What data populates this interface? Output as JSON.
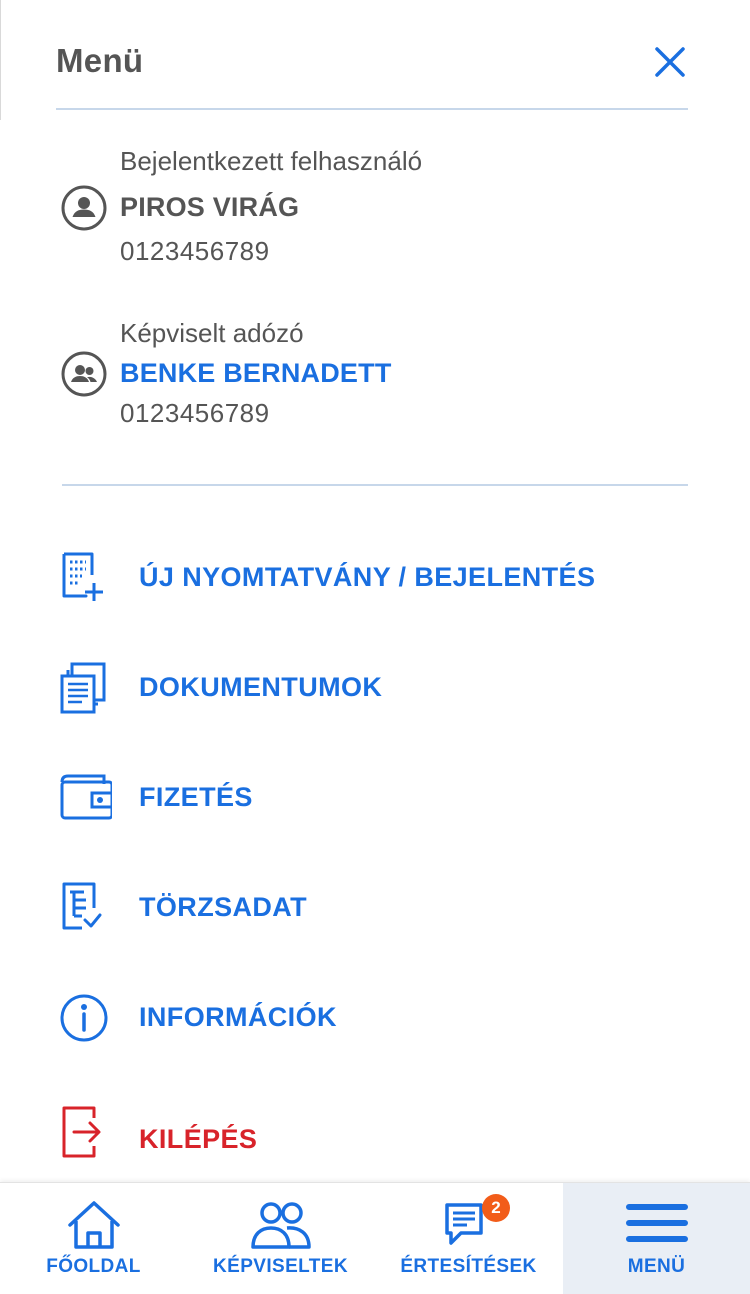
{
  "header": {
    "title": "Menü",
    "close_icon": "close-icon"
  },
  "logged_in_user": {
    "caption": "Bejelentkezett felhasználó",
    "name": "PIROS VIRÁG",
    "tax_id": "0123456789",
    "icon": "user-avatar-icon"
  },
  "represented_taxpayer": {
    "caption": "Képviselt adózó",
    "name": "BENKE BERNADETT",
    "tax_id": "0123456789",
    "icon": "group-avatar-icon"
  },
  "menu": {
    "items": [
      {
        "label": "ÚJ NYOMTATVÁNY / BEJELENTÉS",
        "icon": "new-form-icon"
      },
      {
        "label": "DOKUMENTUMOK",
        "icon": "documents-icon"
      },
      {
        "label": "FIZETÉS",
        "icon": "wallet-icon"
      },
      {
        "label": "TÖRZSADAT",
        "icon": "master-data-icon"
      },
      {
        "label": "INFORMÁCIÓK",
        "icon": "info-icon"
      },
      {
        "label": "KILÉPÉS",
        "icon": "logout-icon"
      }
    ]
  },
  "bottom_nav": {
    "items": [
      {
        "label": "FŐOLDAL",
        "icon": "home-icon"
      },
      {
        "label": "KÉPVISELTEK",
        "icon": "people-icon"
      },
      {
        "label": "ÉRTESÍTÉSEK",
        "icon": "chat-icon",
        "badge": "2"
      },
      {
        "label": "MENÜ",
        "icon": "hamburger-icon",
        "active": true
      }
    ]
  },
  "colors": {
    "accent": "#1a6fe0",
    "danger": "#d8232a",
    "text": "#555555",
    "divider": "#c7d7ea",
    "badge": "#f25c19",
    "active_nav_bg": "#e9eef5"
  }
}
